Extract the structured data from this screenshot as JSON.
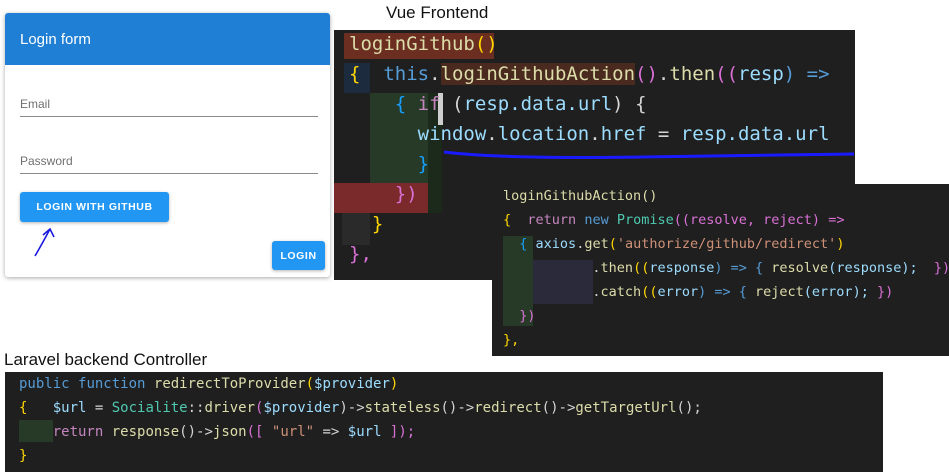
{
  "captions": {
    "vue": "Vue Frontend",
    "laravel": "Laravel backend Controller"
  },
  "login_form": {
    "title": "Login form",
    "email_label": "Email",
    "password_label": "Password",
    "github_button": "LOGIN WITH GITHUB",
    "login_button": "LOGIN",
    "header_color": "#1f7fd4",
    "button_color": "#2196f3",
    "annotation_icon": "hand-drawn-arrow-icon"
  },
  "vue_code": {
    "line1": {
      "fn": "loginGithub",
      "parens": "()"
    },
    "line2": {
      "brace": "{",
      "this_kw": "this",
      "dot1": ".",
      "action": "loginGithubAction",
      "call": "()",
      "dot2": ".",
      "then": "then",
      "open": "((",
      "param": "resp",
      "arrow": ") =>"
    },
    "line3": {
      "brace": "{",
      "if_kw": "if",
      "open": " (",
      "cond": "resp.data.url",
      "close": ")",
      "brace2": " {"
    },
    "line4": {
      "window": "window",
      "dot1": ".",
      "location": "location",
      "dot2": ".",
      "href": "href",
      "eq": " = ",
      "value": "resp.data.url"
    },
    "line5": "}",
    "line6": "})",
    "line7": "}",
    "line8": "},"
  },
  "axios_code": {
    "line1": "loginGithubAction()",
    "line2": {
      "brace": "{",
      "return_kw": "return",
      "new_kw": "new",
      "promise": "Promise",
      "params": "((resolve, reject) =>"
    },
    "line3": {
      "brace": "{",
      "axios": "axios",
      "dot": ".",
      "get": "get",
      "open": "(",
      "url": "'authorize/github/redirect'",
      "close": ")"
    },
    "line4": {
      "dot": ".",
      "then": "then",
      "open": "((",
      "param": "response",
      "arrow": ") => {",
      "resolve": "resolve",
      "arg": "(response);",
      "close": "})"
    },
    "line5": {
      "dot": ".",
      "catch": "catch",
      "open": "((",
      "param": "error",
      "arrow": ") => {",
      "reject": "reject",
      "arg": "(error);",
      "close": "})"
    },
    "line6": "})",
    "line7": "},"
  },
  "laravel_code": {
    "line1": {
      "public_kw": "public",
      "function_kw": "function",
      "name": "redirectToProvider",
      "open": "(",
      "param": "$provider",
      "close": ")"
    },
    "line2": {
      "brace": "{",
      "var": "$url",
      "eq": " = ",
      "cls": "Socialite",
      "sep": "::",
      "driver": "driver",
      "open": "(",
      "param": "$provider",
      "close": ")->",
      "stateless": "stateless",
      "c1": "()->",
      "redirect": "redirect",
      "c2": "()->",
      "target": "getTargetUrl",
      "end": "();"
    },
    "line3": {
      "return_kw": "return",
      "response": "response",
      "c1": "()->",
      "json": "json",
      "open": "([ ",
      "key": "\"url\"",
      "arrow": " => ",
      "var": "$url",
      "close": " ]);"
    },
    "line4": "}"
  },
  "colors": {
    "editor_bg": "#1f1f1f",
    "underline_blue": "#1a1aff",
    "keyword": "#569cd6",
    "function": "#dcdcaa",
    "variable": "#9cdcfe",
    "string": "#ce9178"
  }
}
